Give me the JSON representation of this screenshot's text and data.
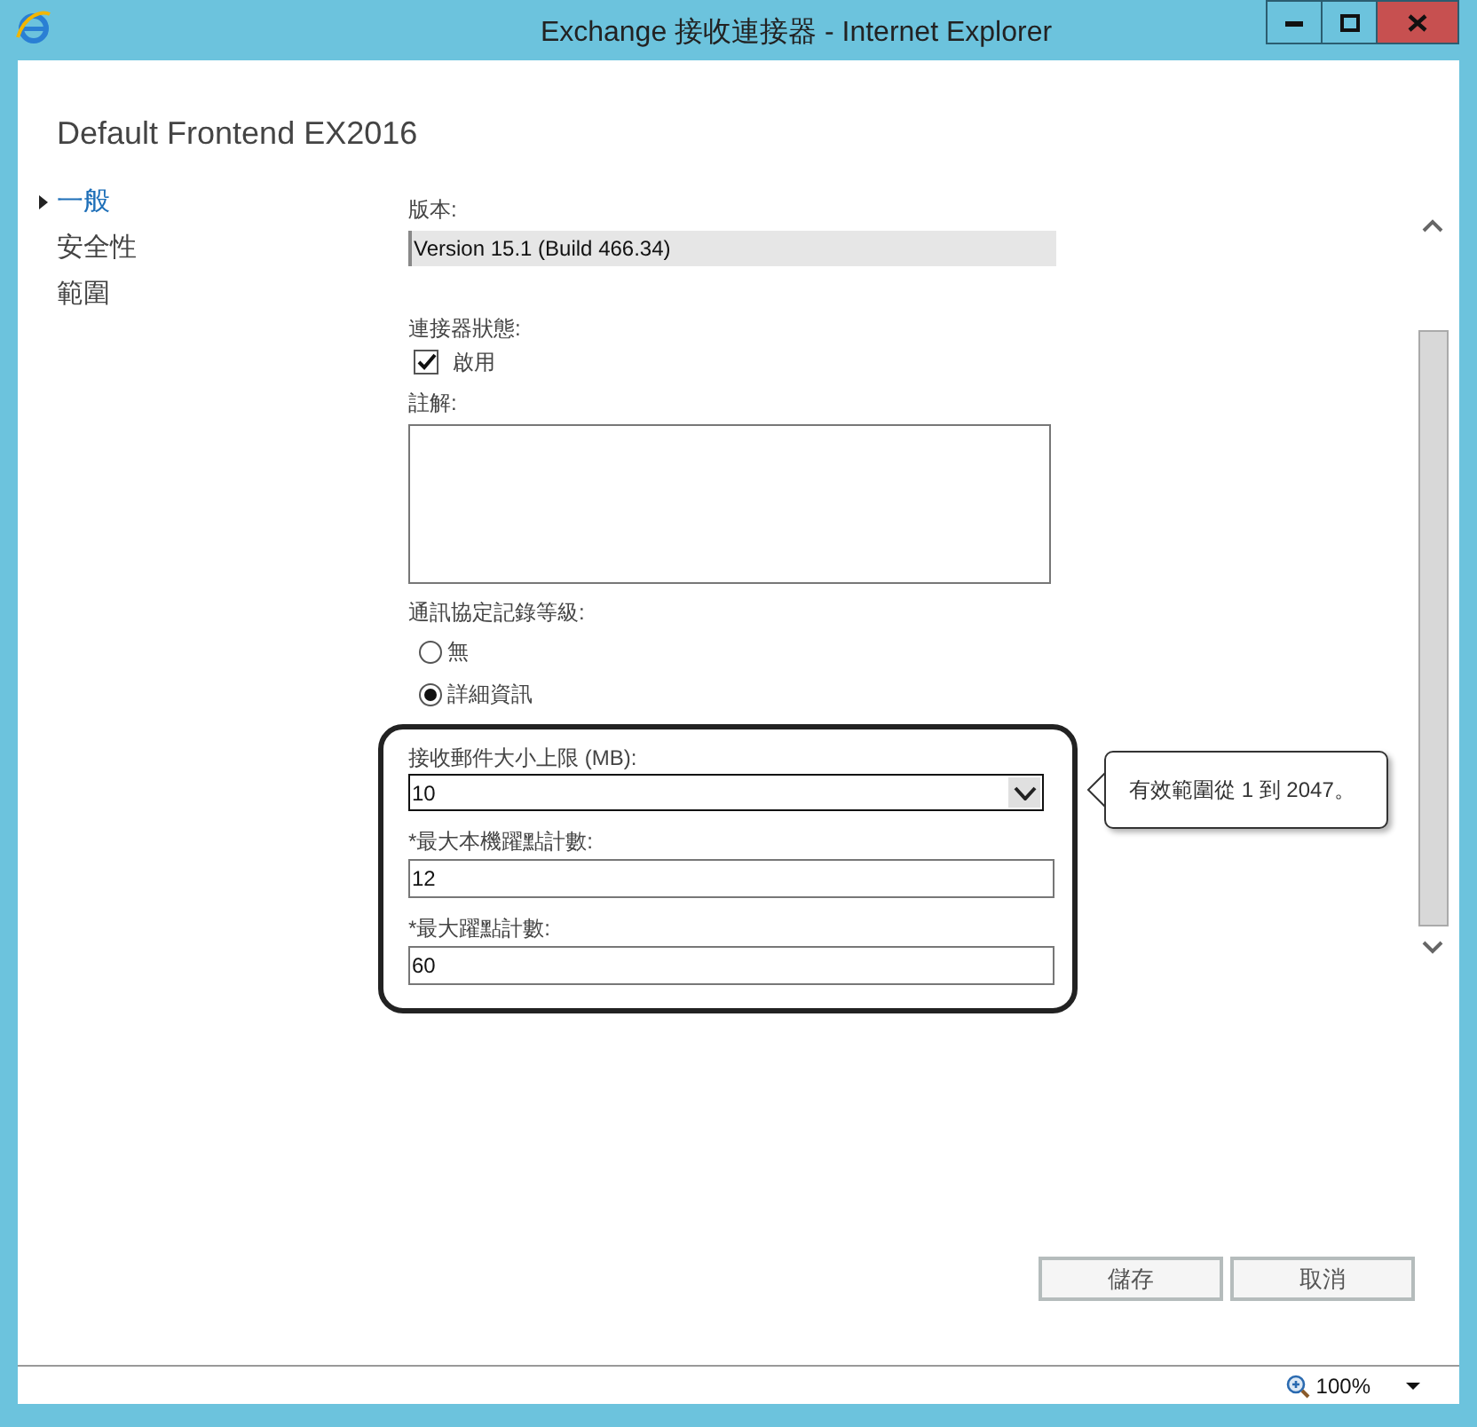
{
  "window": {
    "title": "Exchange 接收連接器 - Internet Explorer"
  },
  "page_title": "Default Frontend EX2016",
  "nav": [
    {
      "label": "一般",
      "selected": true
    },
    {
      "label": "安全性",
      "selected": false
    },
    {
      "label": "範圍",
      "selected": false
    }
  ],
  "form": {
    "version": {
      "label": "版本:",
      "value": "Version 15.1 (Build 466.34)"
    },
    "status": {
      "label": "連接器狀態:",
      "checkbox": {
        "label": "啟用",
        "checked": true
      }
    },
    "comment": {
      "label": "註解:"
    },
    "logging": {
      "label": "通訊協定記錄等級:",
      "options": [
        {
          "label": "無",
          "selected": false
        },
        {
          "label": "詳細資訊",
          "selected": true
        }
      ]
    },
    "limits": [
      {
        "kind": "dropdown",
        "label": "接收郵件大小上限 (MB):",
        "value": "10"
      },
      {
        "kind": "text",
        "label": "*最大本機躍點計數:",
        "value": "12"
      },
      {
        "kind": "text",
        "label": "*最大躍點計數:",
        "value": "60"
      }
    ]
  },
  "tooltip": "有效範圍從 1 到 2047。",
  "buttons": [
    "儲存",
    "取消"
  ],
  "status_bar": {
    "zoom": "100%"
  }
}
